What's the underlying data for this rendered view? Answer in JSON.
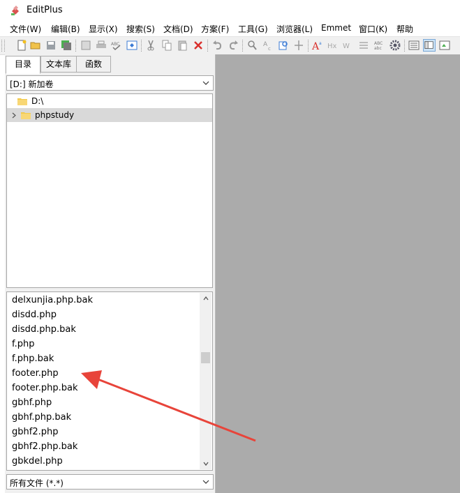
{
  "window": {
    "title": "EditPlus"
  },
  "menu": [
    "文件(W)",
    "编辑(B)",
    "显示(X)",
    "搜索(S)",
    "文档(D)",
    "方案(F)",
    "工具(G)",
    "浏览器(L)",
    "Emmet",
    "窗口(K)",
    "帮助"
  ],
  "toolbar": {
    "buttons": [
      "new-file-icon",
      "open-folder-icon",
      "save-icon",
      "save-all-icon",
      "print-preview-icon",
      "print-icon",
      "spell-check-icon",
      "browser-preview-icon",
      "cut-icon",
      "copy-icon",
      "paste-icon",
      "delete-icon",
      "undo-icon",
      "redo-icon",
      "find-icon",
      "replace-icon",
      "find-in-files-icon",
      "goto-line-icon",
      "font-icon",
      "heading-icon",
      "wordwrap-icon",
      "column-select-icon",
      "abc-icon",
      "gear-icon",
      "view-list-icon",
      "split-view-icon",
      "panel-icon"
    ]
  },
  "sidebar": {
    "tabs": [
      "目录",
      "文本库",
      "函数"
    ],
    "active_tab": "目录",
    "drive": "[D:] 新加卷",
    "tree": [
      {
        "label": "D:\\",
        "level": 0
      },
      {
        "label": "phpstudy",
        "level": 1,
        "selected": true
      }
    ],
    "files": [
      "delxunjia.php.bak",
      "disdd.php",
      "disdd.php.bak",
      "f.php",
      "f.php.bak",
      "footer.php",
      "footer.php.bak",
      "gbhf.php",
      "gbhf.php.bak",
      "gbhf2.php",
      "gbhf2.php.bak",
      "gbkdel.php"
    ],
    "filter": "所有文件 (*.*)"
  },
  "colors": {
    "editor_bg": "#ababab",
    "arrow": "#e8443a",
    "selected_row": "#d9d9d9"
  }
}
